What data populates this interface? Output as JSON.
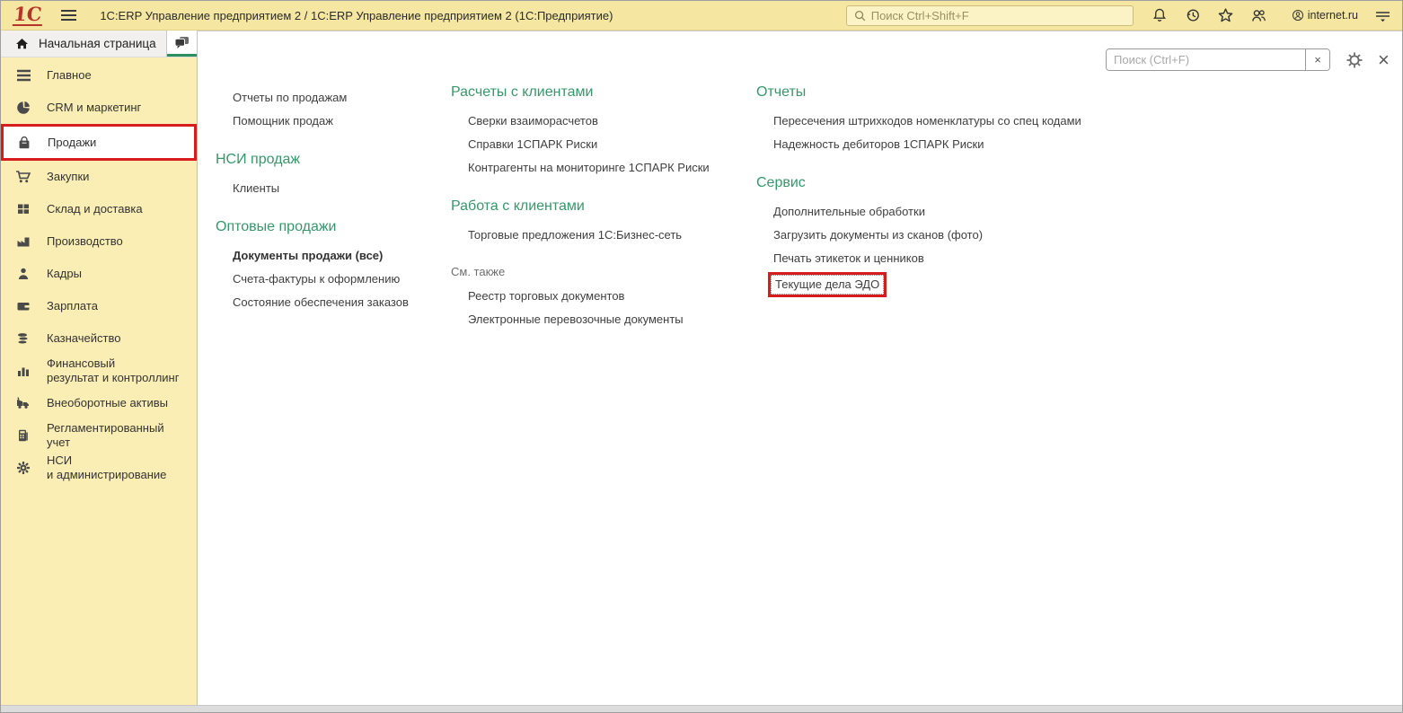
{
  "colors": {
    "topbar_yellow": "#f5e7a1",
    "sidebar_yellow": "#faeeb4",
    "header_green": "#36986a",
    "tab_underline_green": "#2e8f5e",
    "annotation_red": "#d61c1c",
    "logo_red": "#b5342b"
  },
  "titlebar": {
    "logo": "1С",
    "title": "1С:ERP Управление предприятием 2 / 1С:ERP Управление предприятием 2  (1С:Предприятие)",
    "search_placeholder": "Поиск Ctrl+Shift+F",
    "icons": [
      "bell-icon",
      "history-icon",
      "star-icon",
      "users-icon"
    ],
    "service_label": "internet.ru"
  },
  "tabs": {
    "home_label": "Начальная страница"
  },
  "sidebar": {
    "items": [
      {
        "label": "Главное",
        "icon": "menu-icon",
        "selected": false
      },
      {
        "label": "CRM и маркетинг",
        "icon": "pie-chart-icon",
        "selected": false
      },
      {
        "label": "Продажи",
        "icon": "shopping-bag-icon",
        "selected": true
      },
      {
        "label": "Закупки",
        "icon": "shopping-cart-icon",
        "selected": false
      },
      {
        "label": "Склад и доставка",
        "icon": "warehouse-icon",
        "selected": false
      },
      {
        "label": "Производство",
        "icon": "factory-icon",
        "selected": false
      },
      {
        "label": "Кадры",
        "icon": "person-icon",
        "selected": false
      },
      {
        "label": "Зарплата",
        "icon": "wallet-icon",
        "selected": false
      },
      {
        "label": "Казначейство",
        "icon": "coins-icon",
        "selected": false
      },
      {
        "label": "Финансовый\nрезультат и контроллинг",
        "icon": "bar-chart-icon",
        "selected": false
      },
      {
        "label": "Внеоборотные активы",
        "icon": "truck-icon",
        "selected": false
      },
      {
        "label": "Регламентированный\nучет",
        "icon": "calculator-icon",
        "selected": false
      },
      {
        "label": "НСИ\nи администрирование",
        "icon": "gear-icon",
        "selected": false
      }
    ]
  },
  "panel": {
    "search_placeholder": "Поиск (Ctrl+F)",
    "clear_label": "×",
    "close_label": "×",
    "columns": [
      {
        "blocks": [
          {
            "links": [
              {
                "label": "Отчеты по продажам"
              },
              {
                "label": "Помощник продаж"
              }
            ]
          },
          {
            "header": "НСИ продаж",
            "links": [
              {
                "label": "Клиенты"
              }
            ]
          },
          {
            "header": "Оптовые продажи",
            "links": [
              {
                "label": "Документы продажи (все)",
                "bold": true
              },
              {
                "label": "Счета-фактуры к оформлению"
              },
              {
                "label": "Состояние обеспечения заказов"
              }
            ]
          }
        ]
      },
      {
        "blocks": [
          {
            "header": "Расчеты с клиентами",
            "links": [
              {
                "label": "Сверки взаиморасчетов"
              },
              {
                "label": "Справки 1СПАРК Риски"
              },
              {
                "label": "Контрагенты на мониторинге 1СПАРК Риски"
              }
            ]
          },
          {
            "header": "Работа с клиентами",
            "links": [
              {
                "label": "Торговые предложения 1С:Бизнес-сеть"
              }
            ]
          },
          {
            "see_also": "См. также",
            "links": [
              {
                "label": "Реестр торговых документов"
              },
              {
                "label": "Электронные перевозочные документы"
              }
            ]
          }
        ]
      },
      {
        "blocks": [
          {
            "header": "Отчеты",
            "links": [
              {
                "label": "Пересечения штрихкодов номенклатуры со спец кодами"
              },
              {
                "label": "Надежность дебиторов 1СПАРК Риски"
              }
            ]
          },
          {
            "header": "Сервис",
            "links": [
              {
                "label": "Дополнительные обработки"
              },
              {
                "label": "Загрузить документы из сканов (фото)"
              },
              {
                "label": "Печать этикеток и ценников"
              },
              {
                "label": "Текущие дела ЭДО",
                "highlighted": true
              }
            ]
          }
        ]
      }
    ]
  }
}
